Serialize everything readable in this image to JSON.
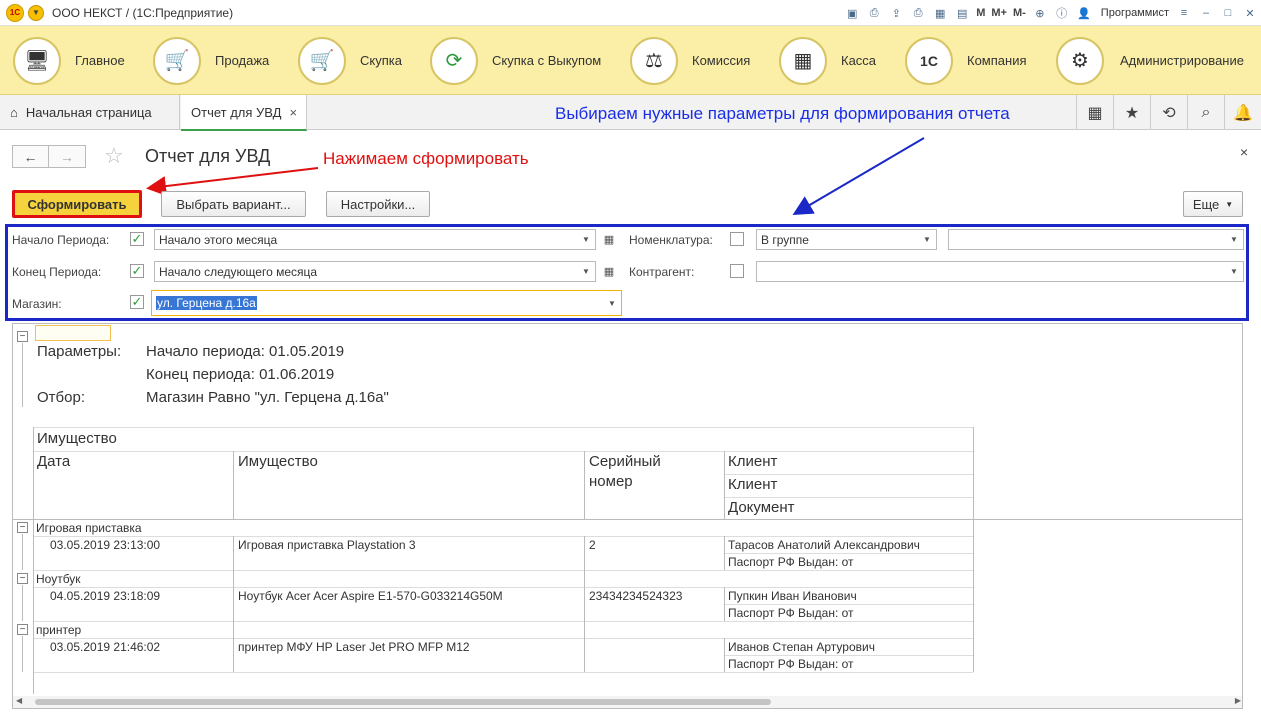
{
  "titlebar": {
    "logo": "1С",
    "title": "ООО НЕКСТ / (1С:Предприятие)",
    "mem": [
      "M",
      "M+",
      "M-"
    ],
    "user": "Программист",
    "icons": [
      "save-icon",
      "print-icon",
      "upload-icon",
      "printer-icon",
      "calculator-icon",
      "calendar-icon",
      "zoom-icon",
      "info-icon",
      "menu-icon",
      "minimize-icon",
      "maximize-icon",
      "close-icon"
    ]
  },
  "sections": [
    {
      "label": "Главное",
      "icon": "desktop-icon"
    },
    {
      "label": "Продажа",
      "icon": "cart-up-icon"
    },
    {
      "label": "Скупка",
      "icon": "cart-down-icon"
    },
    {
      "label": "Скупка с Выкупом",
      "icon": "cycle-icon"
    },
    {
      "label": "Комиссия",
      "icon": "scales-icon"
    },
    {
      "label": "Касса",
      "icon": "cash-register-icon"
    },
    {
      "label": "Компания",
      "icon": "company-1c-icon",
      "icon_text": "1C"
    },
    {
      "label": "Администрирование",
      "icon": "gears-icon"
    }
  ],
  "tabs": {
    "home": "Начальная страница",
    "active": "Отчет для УВД",
    "close": "×"
  },
  "annotations": {
    "blue": "Выбираем нужные параметры для формирования отчета",
    "red": "Нажимаем сформировать"
  },
  "form": {
    "title": "Отчет для УВД",
    "close": "×"
  },
  "commands": {
    "generate": "Сформировать",
    "variant": "Выбрать вариант...",
    "settings": "Настройки...",
    "more": "Еще"
  },
  "filters": {
    "period_start": {
      "label": "Начало Периода:",
      "checked": true,
      "value": "Начало этого месяца"
    },
    "period_end": {
      "label": "Конец Периода:",
      "checked": true,
      "value": "Начало следующего месяца"
    },
    "store": {
      "label": "Магазин:",
      "checked": true,
      "value": "ул. Герцена д.16а"
    },
    "nomenclature": {
      "label": "Номенклатура:",
      "checked": false,
      "mode": "В группе",
      "value": ""
    },
    "counterparty": {
      "label": "Контрагент:",
      "checked": false,
      "value": ""
    }
  },
  "report": {
    "params_label": "Параметры:",
    "param1": "Начало периода: 01.05.2019",
    "param2": "Конец периода: 01.06.2019",
    "filter_label": "Отбор:",
    "filter_value": "Магазин Равно \"ул. Герцена д.16а\"",
    "table_title": "Имущество",
    "headers": {
      "date": "Дата",
      "item": "Имущество",
      "serial1": "Серийный",
      "serial2": "номер",
      "client1": "Клиент",
      "client2": "Клиент",
      "document": "Документ"
    },
    "groups": [
      {
        "name": "Игровая приставка",
        "date": "03.05.2019 23:13:00",
        "item": "Игровая приставка Playstation 3",
        "serial": "2",
        "client": "Тарасов Анатолий Александрович",
        "document": "Паспорт РФ Выдан: от"
      },
      {
        "name": "Ноутбук",
        "date": "04.05.2019 23:18:09",
        "item": "Ноутбук Acer Acer Aspire E1-570-G033214G50M",
        "serial": "23434234524323",
        "client": "Пупкин Иван Иванович",
        "document": "Паспорт РФ Выдан: от"
      },
      {
        "name": "принтер",
        "date": "03.05.2019 21:46:02",
        "item": "принтер МФУ HP Laser Jet PRO MFP M12",
        "serial": "",
        "client": "Иванов Степан Артурович",
        "document": "Паспорт РФ Выдан: от"
      }
    ]
  }
}
